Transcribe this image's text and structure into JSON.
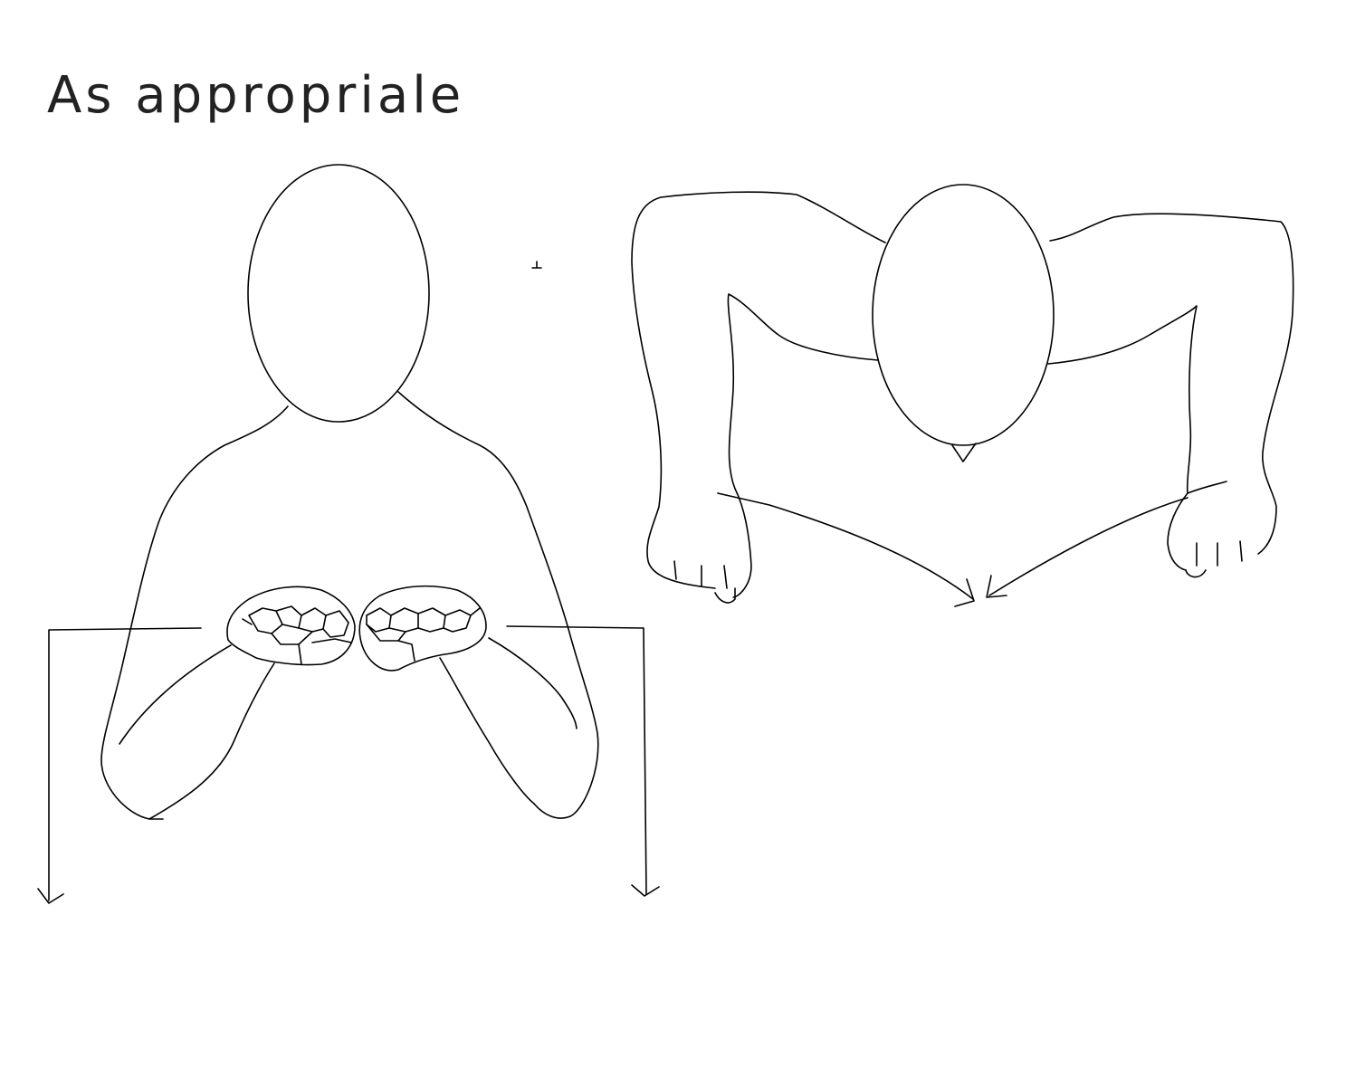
{
  "diagram": {
    "caption": "As appropriale",
    "ink_color": "#000000",
    "background_color": "#ffffff",
    "views": [
      {
        "id": "front-view",
        "subject": "signer-front"
      },
      {
        "id": "top-view",
        "subject": "signer-top-down"
      }
    ]
  }
}
